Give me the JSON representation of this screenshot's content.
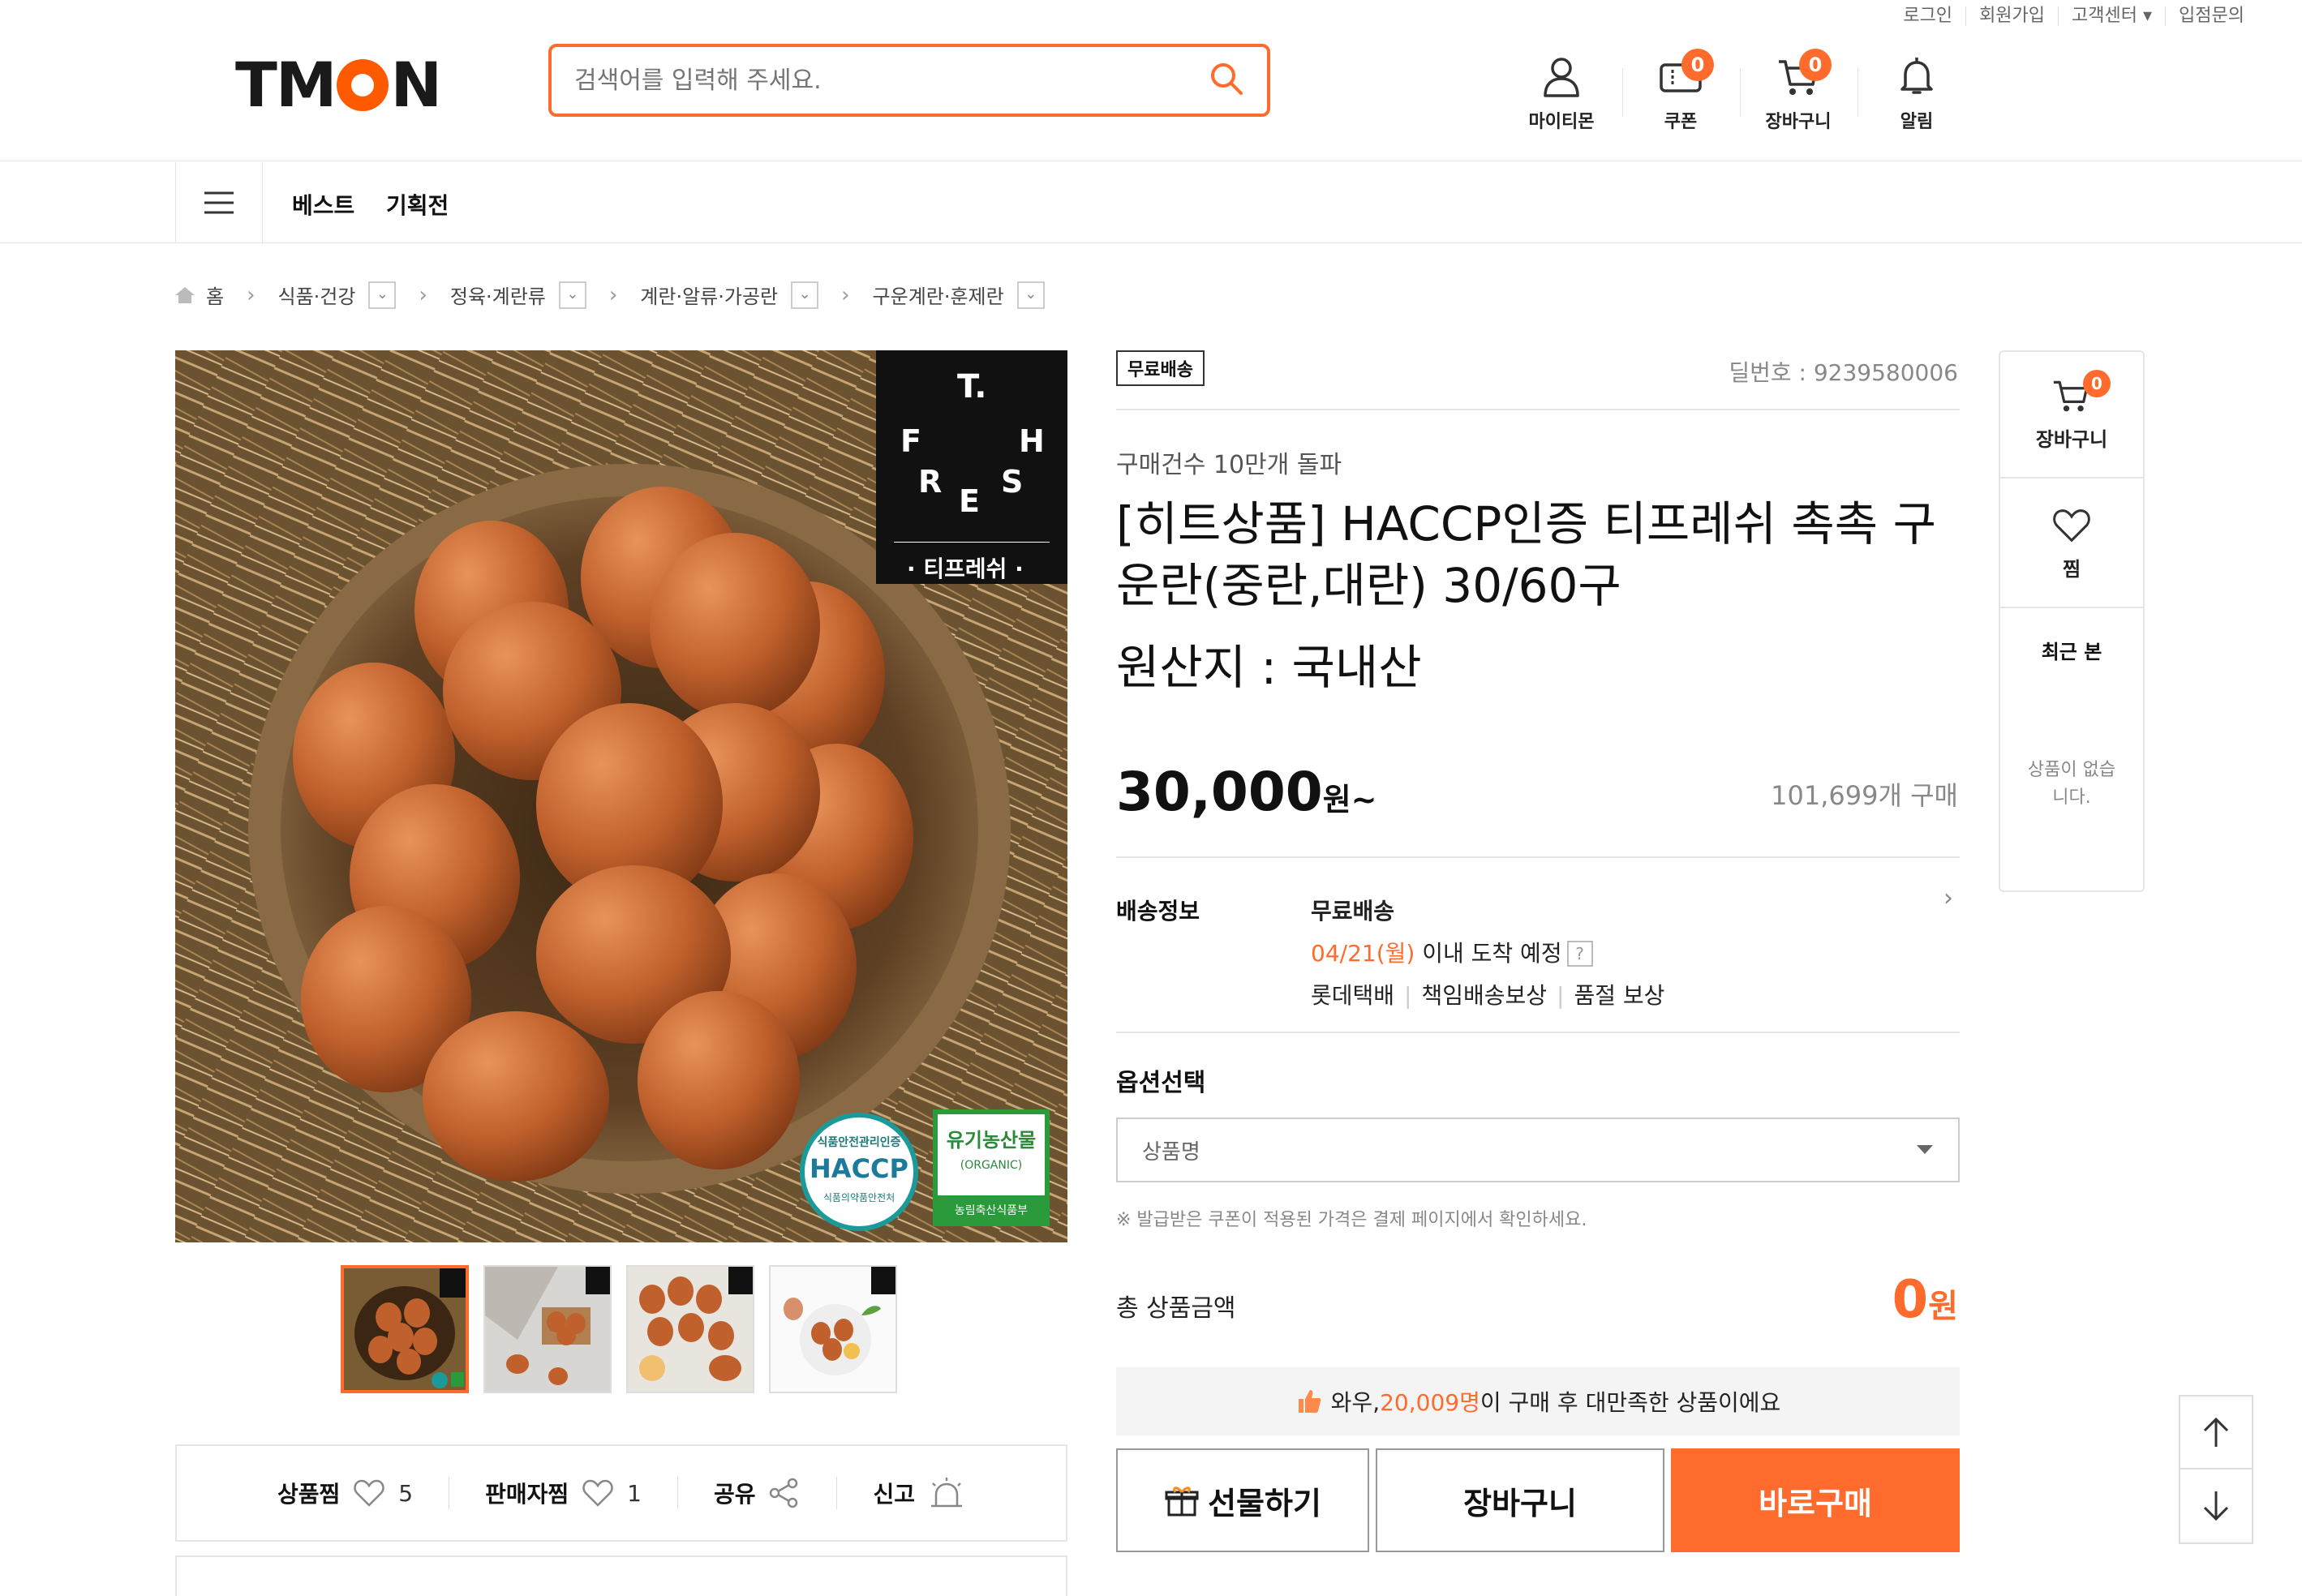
{
  "util_links": [
    "로그인",
    "회원가입",
    "고객센터 ▾",
    "입점문의"
  ],
  "logo": {
    "pre": "TM",
    "post": "N"
  },
  "search": {
    "placeholder": "검색어를 입력해 주세요."
  },
  "header_icons": [
    {
      "label": "마이티몬",
      "icon": "person-icon"
    },
    {
      "label": "쿠폰",
      "icon": "coupon-icon",
      "badge": "0"
    },
    {
      "label": "장바구니",
      "icon": "cart-icon",
      "badge": "0"
    },
    {
      "label": "알림",
      "icon": "bell-icon"
    }
  ],
  "nav": {
    "best": "베스트",
    "event": "기획전"
  },
  "breadcrumb": {
    "home": "홈",
    "c1": "식품·건강",
    "c2": "정육·계란류",
    "c3": "계란·알류·가공란",
    "c4": "구운계란·훈제란"
  },
  "brand_box": {
    "t": "T.",
    "f": "F",
    "h": "H",
    "r": "R",
    "e": "E",
    "s": "S",
    "name": "· 티프레쉬 ·"
  },
  "cert": {
    "haccp_top": "식품안전관리인증",
    "haccp": "HACCP",
    "haccp_bottom": "식품의약품안전처",
    "organic": "유기농산물",
    "organic_en": "(ORGANIC)",
    "organic_bottom": "농림축산식품부"
  },
  "social": {
    "like_label": "상품찜",
    "like_count": "5",
    "seller_label": "판매자찜",
    "seller_count": "1",
    "share": "공유",
    "report": "신고"
  },
  "product": {
    "tag": "무료배송",
    "deal_no": "딜번호 : 9239580006",
    "subtitle": "구매건수 10만개 돌파",
    "title": "[히트상품] HACCP인증 티프레쉬 촉촉 구운란(중란,대란) 30/60구",
    "origin": "원산지 : 국내산",
    "price": "30,000",
    "price_unit": "원~",
    "sold": "101,699개 구매"
  },
  "shipping": {
    "label": "배송정보",
    "type": "무료배송",
    "date": "04/21(월)",
    "date_suffix": " 이내 도착 예정",
    "q": "?",
    "carrier": "롯데택배",
    "guarantee1": "책임배송보상",
    "guarantee2": "품절 보상"
  },
  "options": {
    "label": "옵션선택",
    "select_placeholder": "상품명",
    "note": "※ 발급받은 쿠폰이 적용된 가격은 결제 페이지에서 확인하세요."
  },
  "total": {
    "label": "총 상품금액",
    "value": "0",
    "unit": "원"
  },
  "review": {
    "pre": "와우, ",
    "count": "20,009명",
    "post": "이 구매 후 대만족한 상품이에요"
  },
  "buttons": {
    "gift": "선물하기",
    "cart": "장바구니",
    "buy": "바로구매"
  },
  "side": {
    "cart": "장바구니",
    "cart_badge": "0",
    "wish": "찜",
    "recent": "최근 본",
    "empty": "상품이 없습니다."
  },
  "colors": {
    "accent": "#ff6b2c",
    "border": "#e5e5e5"
  }
}
